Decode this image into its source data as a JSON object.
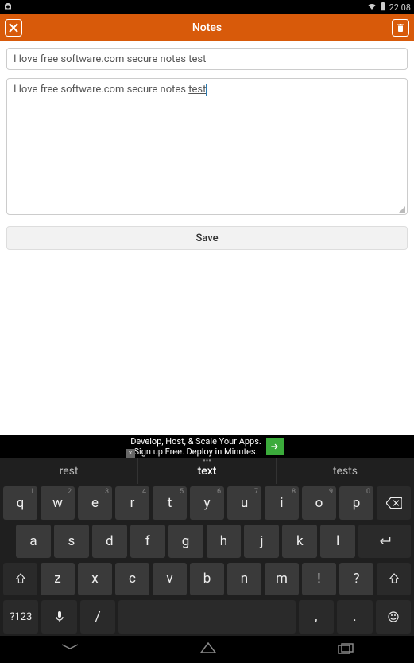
{
  "status": {
    "time": "22:08"
  },
  "header": {
    "title": "Notes"
  },
  "note": {
    "title_value": "I love free software.com secure notes test",
    "body_prefix": "I love free software.com secure notes ",
    "body_underlined": "test"
  },
  "actions": {
    "save_label": "Save"
  },
  "ad": {
    "line1": "Develop, Host, & Scale Your Apps.",
    "line2": "Sign up Free. Deploy in Minutes.",
    "close": "×"
  },
  "suggestions": {
    "left": "rest",
    "center": "text",
    "right": "tests"
  },
  "keys": {
    "row1": [
      {
        "main": "q",
        "sup": "1"
      },
      {
        "main": "w",
        "sup": "2"
      },
      {
        "main": "e",
        "sup": "3"
      },
      {
        "main": "r",
        "sup": "4"
      },
      {
        "main": "t",
        "sup": "5"
      },
      {
        "main": "y",
        "sup": "6"
      },
      {
        "main": "u",
        "sup": "7"
      },
      {
        "main": "i",
        "sup": "8"
      },
      {
        "main": "o",
        "sup": "9"
      },
      {
        "main": "p",
        "sup": "0"
      }
    ],
    "row2": [
      "a",
      "s",
      "d",
      "f",
      "g",
      "h",
      "j",
      "k",
      "l"
    ],
    "row3": [
      "z",
      "x",
      "c",
      "v",
      "b",
      "n",
      "m",
      "!",
      "?"
    ],
    "row4": {
      "sym": "?123",
      "slash": "/",
      "comma": ",",
      "dot": "."
    }
  }
}
